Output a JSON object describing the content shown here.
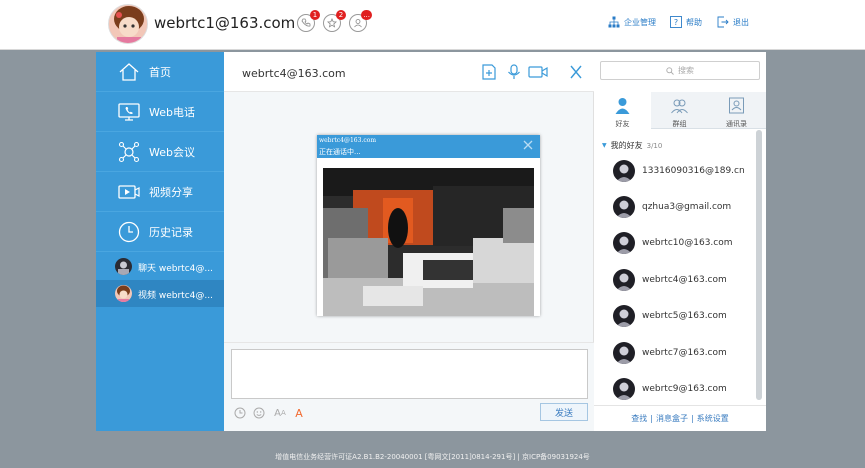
{
  "header": {
    "username": "webrtc1@163.com",
    "badges": {
      "phone": "1",
      "star": "2",
      "contacts": "..."
    },
    "links": [
      {
        "label": "企业管理"
      },
      {
        "label": "帮助"
      },
      {
        "label": "退出"
      }
    ]
  },
  "sidebar": {
    "nav": [
      {
        "label": "首页",
        "icon": "home-icon"
      },
      {
        "label": "Web电话",
        "icon": "monitor-phone-icon"
      },
      {
        "label": "Web会议",
        "icon": "conference-icon"
      },
      {
        "label": "视频分享",
        "icon": "video-play-icon"
      },
      {
        "label": "历史记录",
        "icon": "clock-icon"
      }
    ],
    "sessions": [
      {
        "label": "聊天 webrtc4@..."
      },
      {
        "label": "视频 webrtc4@..."
      }
    ]
  },
  "chat": {
    "title": "webrtc4@163.com",
    "video": {
      "peer": "webrtc4@163.com",
      "status": "正在通话中..."
    },
    "input_placeholder": "",
    "send_label": "发送",
    "font_size_label": "A",
    "font_color_label": "A"
  },
  "contacts": {
    "search_placeholder": "搜索",
    "tabs": [
      {
        "label": "好友"
      },
      {
        "label": "群组"
      },
      {
        "label": "通讯录"
      }
    ],
    "group": {
      "label": "我的好友",
      "count": "3/10"
    },
    "list": [
      {
        "name": "13316090316@189.cn"
      },
      {
        "name": "qzhua3@gmail.com"
      },
      {
        "name": "webrtc10@163.com"
      },
      {
        "name": "webrtc4@163.com"
      },
      {
        "name": "webrtc5@163.com"
      },
      {
        "name": "webrtc7@163.com"
      },
      {
        "name": "webrtc9@163.com"
      }
    ],
    "footer": [
      "查找",
      "消息盒子",
      "系统设置"
    ]
  },
  "footer_note": "增值电信业务经营许可证A2.B1.B2-20040001 [粤网文[2011]0814-291号] | 京ICP备09031924号",
  "colors": {
    "accent": "#3a9ad9",
    "accent_dark": "#2f86c2",
    "badge": "#e02020",
    "page_bg": "#8c969e"
  }
}
